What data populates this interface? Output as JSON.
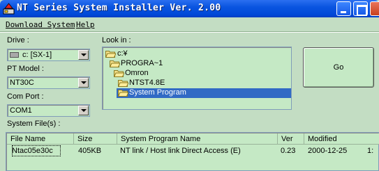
{
  "window": {
    "title": "NT Series System Installer Ver. 2.00",
    "icon": "installer-app-icon"
  },
  "menu": {
    "items": [
      "Download System",
      "Help"
    ]
  },
  "drive": {
    "label": "Drive :",
    "value": "c: [SX-1]",
    "icon": "hard-drive-icon"
  },
  "pt_model": {
    "label": "PT Model :",
    "value": "NT30C"
  },
  "com_port": {
    "label": "Com Port :",
    "value": "COM1"
  },
  "look_in": {
    "label": "Look in :",
    "folders": [
      {
        "name": "c:¥",
        "selected": false
      },
      {
        "name": "PROGRA~1",
        "selected": false
      },
      {
        "name": "Omron",
        "selected": false
      },
      {
        "name": "NTST4.8E",
        "selected": false
      },
      {
        "name": "System Program",
        "selected": true
      }
    ]
  },
  "go_button": {
    "label": "Go"
  },
  "system_files": {
    "label": "System File(s) :",
    "columns": [
      "File Name",
      "Size",
      "System Program Name",
      "Ver",
      "Modified"
    ],
    "rows": [
      [
        "Ntac05e30c",
        "405KB",
        "NT link / Host link Direct Access (E)",
        "0.23",
        "2000-12-25",
        "1:"
      ]
    ]
  },
  "colors": {
    "title_bar": "#0a55e0",
    "background": "#c3ddc3",
    "field": "#c5e9c5",
    "selection": "#316ac5"
  }
}
